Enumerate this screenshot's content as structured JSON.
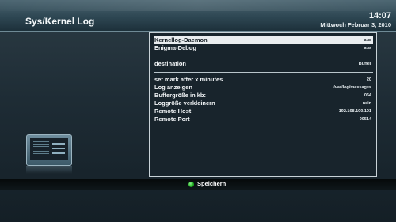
{
  "header": {
    "title": "Sys/Kernel Log",
    "clock": "14:07",
    "date": "Mittwoch Februar 3, 2010"
  },
  "settings": [
    {
      "label": "Kernellog-Daemon",
      "value": "aus",
      "selected": true
    },
    {
      "label": "Enigma-Debug",
      "value": "aus"
    },
    {
      "label": "destination",
      "value": "Buffer"
    },
    {
      "label": "set mark after x minutes",
      "value": "20"
    },
    {
      "label": "Log anzeigen",
      "value": "/var/log/messages"
    },
    {
      "label": "Buffergröße in kb:",
      "value": "064"
    },
    {
      "label": "Loggröße verkleinern",
      "value": "nein"
    },
    {
      "label": "Remote Host",
      "value": "192.168.100.101"
    },
    {
      "label": "Remote Port",
      "value": "00514"
    }
  ],
  "footer": {
    "green_button_label": "Speichern",
    "green_button_color": "#22b022"
  },
  "icons": {
    "left_graphic": "tv-screen-icon",
    "green_key": "green-button-icon"
  }
}
